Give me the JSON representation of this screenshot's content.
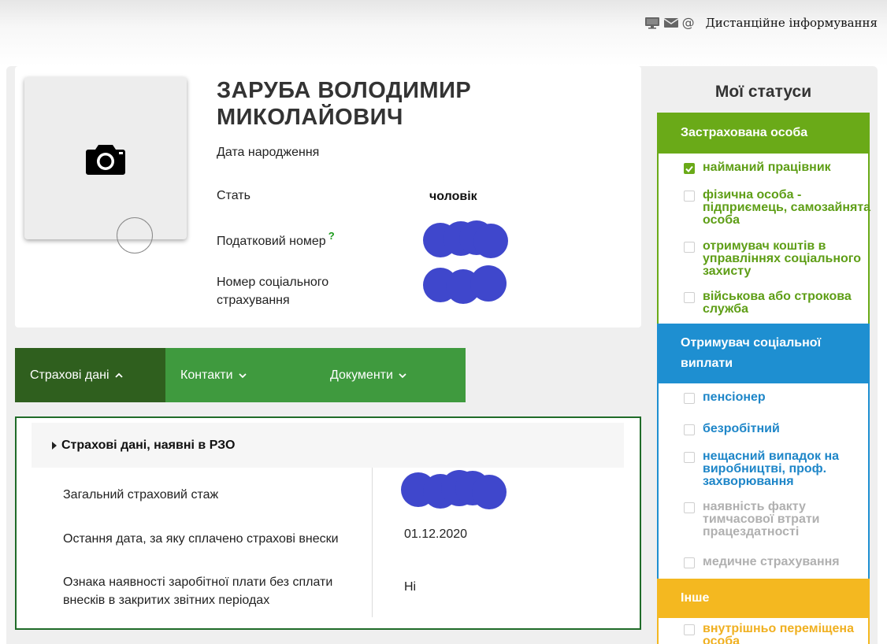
{
  "top_bar": {
    "label": "Дистанційне інформування",
    "icons": [
      "monitor-icon",
      "envelope-icon",
      "at-sign-icon"
    ],
    "at_symbol": "@"
  },
  "profile": {
    "name": "ЗАРУБА ВОЛОДИМИР МИКОЛАЙОВИЧ",
    "birth_date_label": "Дата народження",
    "gender_label": "Стать",
    "gender_value": "чоловік",
    "tax_number_label": "Податковий номер",
    "tax_help": "?",
    "social_number_label": "Номер соціального страхування",
    "photo_icon": "camera-icon"
  },
  "tabs": [
    {
      "label": "Страхові дані",
      "active": true
    },
    {
      "label": "Контакти",
      "active": false
    },
    {
      "label": "Документи",
      "active": false
    }
  ],
  "insurance": {
    "section_title": "Страхові дані, наявні в РЗО",
    "rows": [
      {
        "label": "Загальний страховий стаж",
        "value": ""
      },
      {
        "label": "Остання дата, за яку сплачено страхові внески",
        "value": "01.12.2020"
      },
      {
        "label": "Ознака наявності заробітної плати без сплати внесків в закритих звітних періодах",
        "value": "Ні"
      }
    ]
  },
  "statuses": {
    "title": "Мої статуси",
    "categories": [
      {
        "header": "Застрахована особа",
        "color": "#6aaa18",
        "items": [
          {
            "label": "найманий працівник",
            "checked": true
          },
          {
            "label": "фізична особа - підприємець, самозайнята особа",
            "checked": false
          },
          {
            "label": "отримувач коштів в управліннях соціального захисту",
            "checked": false
          },
          {
            "label": "військова або строкова служба",
            "checked": false
          }
        ]
      },
      {
        "header": "Отримувач соціальної виплати",
        "color": "#1e8fd1",
        "items": [
          {
            "label": "пенсіонер",
            "checked": false
          },
          {
            "label": "безробітний",
            "checked": false
          },
          {
            "label": "нещасний випадок на виробництві, проф. захворювання",
            "checked": false
          },
          {
            "label": "наявність факту тимчасової втрати працездатності",
            "checked": false
          },
          {
            "label": "медичне страхування",
            "checked": false
          }
        ]
      },
      {
        "header": "Інше",
        "color": "#f4b820",
        "items": [
          {
            "label": "внутрішньо переміщена особа",
            "checked": false
          }
        ]
      }
    ]
  },
  "colors": {
    "tab_bar": "#3f9a3e",
    "tab_active": "#2f5f1e",
    "redaction": "#3f47cc"
  }
}
